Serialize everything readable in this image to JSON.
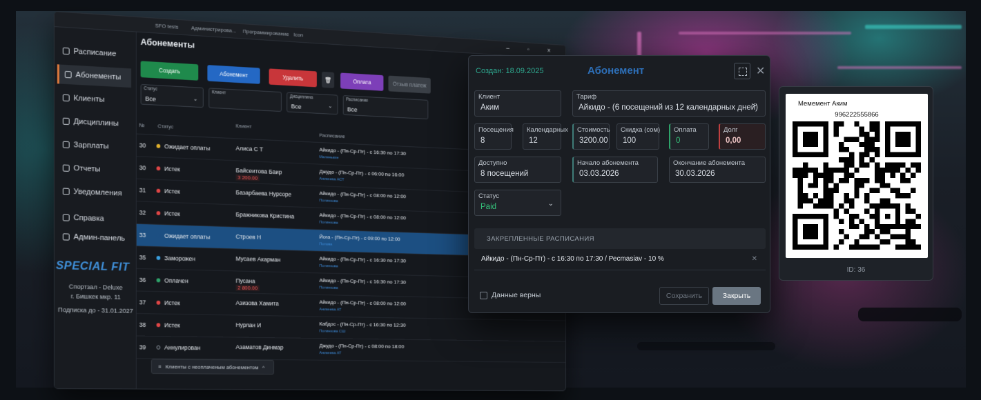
{
  "browser": {
    "bookmarks": [
      "SFO tests",
      "Администрирова...",
      "Программирование",
      "Icon"
    ],
    "window_controls": "– ▫ ×"
  },
  "sidebar": {
    "items": [
      {
        "label": "Расписание",
        "icon": "calendar-icon"
      },
      {
        "label": "Абонементы",
        "icon": "card-icon",
        "active": true
      },
      {
        "label": "Клиенты",
        "icon": "users-icon"
      },
      {
        "label": "Дисциплины",
        "icon": "layers-icon"
      },
      {
        "label": "Зарплаты",
        "icon": "wallet-icon"
      },
      {
        "label": "Отчеты",
        "icon": "report-icon"
      },
      {
        "label": "Уведомления",
        "icon": "bell-icon"
      },
      {
        "label": "Справка",
        "icon": "help-icon"
      },
      {
        "label": "Админ-панель",
        "icon": "admin-icon"
      }
    ],
    "logo": "SPECIAL FIT",
    "plan": "Спортзал - Deluxe",
    "address": "г. Бишкек мкр. 11",
    "subscription": "Подписка до - 31.01.2027"
  },
  "page": {
    "title": "Абонементы",
    "toolbar": {
      "create": "Создать",
      "subscription": "Абонемент",
      "delete": "Удалить",
      "pay": "Оплата",
      "history": "Отзыв платеж"
    },
    "filters": {
      "status_label": "Статус",
      "status_value": "Все",
      "client_label": "Клиент",
      "discipline_label": "Дисциплина",
      "discipline_value": "Все",
      "schedule_label": "Расписание",
      "schedule_value": "Все"
    },
    "columns": {
      "id": "№",
      "status": "Статус",
      "client": "Клиент",
      "schedule": "Расписание"
    },
    "rows": [
      {
        "id": "30",
        "status": "Ожидает оплаты",
        "dot": "#e0b02c",
        "client": "Алиса С Т",
        "debt": "",
        "schedule": "Айкидо - (Пн-Ср-Пт) - с 16:30 по 17:30",
        "sub": "Маленькие"
      },
      {
        "id": "30",
        "status": "Истек",
        "dot": "#e04646",
        "client": "Байсеитова Баир",
        "debt": "3 200.00",
        "schedule": "Джудо - (Пн-Ср-Пт) - с 06:00 по 16:00",
        "sub": "Аникеева АСТ"
      },
      {
        "id": "31",
        "status": "Истек",
        "dot": "#e04646",
        "client": "Базарбаева Нурсоре",
        "debt": "",
        "schedule": "Айкидо - (Пн-Ср-Пт) - с 08:00 по 12:00",
        "sub": "Полинкова"
      },
      {
        "id": "32",
        "status": "Истек",
        "dot": "#e04646",
        "client": "Бражникова Кристина",
        "debt": "",
        "schedule": "Айкидо - (Пн-Ср-Пт) - с 08:00 по 12:00",
        "sub": "Полинкова"
      },
      {
        "id": "33",
        "status": "Ожидает оплаты",
        "dot": "#1c4f82",
        "client": "Строев Н",
        "debt": "",
        "schedule": "Йога - (Пн-Ср-Пт) - с 09:00 по 12:00",
        "sub": "Попова",
        "selected": true
      },
      {
        "id": "35",
        "status": "Заморожен",
        "dot": "#3aa0e0",
        "client": "Мусаев Акарман",
        "debt": "",
        "schedule": "Айкидо - (Пн-Ср-Пт) - с 16:30 по 17:30",
        "sub": "Полинкова"
      },
      {
        "id": "36",
        "status": "Оплачен",
        "dot": "#2ea36a",
        "client": "Пусана",
        "debt": "2 800.00",
        "schedule": "Айкидо - (Пн-Ср-Пт) - с 16:30 по 17:30",
        "sub": "Полинкова"
      },
      {
        "id": "37",
        "status": "Истек",
        "dot": "#e04646",
        "client": "Азизова Хамита",
        "debt": "",
        "schedule": "Айкидо - (Пн-Ср-Пт) - с 08:00 по 12:00",
        "sub": "Аникеева АТ"
      },
      {
        "id": "38",
        "status": "Истек",
        "dot": "#e04646",
        "client": "Нурлан И",
        "debt": "",
        "schedule": "Кабдос - (Пн-Ср-Пт) - с 16:30 по 12:30",
        "sub": "Полинкова СШ"
      },
      {
        "id": "39",
        "status": "Аннулирован",
        "dot": "#1a1d22",
        "client": "Азаматов Динмар",
        "debt": "",
        "schedule": "Джудо - (Пн-Ср-Пт) - с 08:00 по 18:00",
        "sub": "Аникеева АТ"
      }
    ],
    "footer": "Клиенты с неоплаченым абонементом"
  },
  "modal": {
    "created": "Создан: 18.09.2025",
    "title": "Абонемент",
    "client_label": "Клиент",
    "client_value": "Аким",
    "tariff_label": "Тариф",
    "tariff_value": "Айкидо - (6 посещений из 12 календарных дней)",
    "visits_label": "Посещения",
    "visits_value": "8",
    "calendar_label": "Календарных",
    "calendar_value": "12",
    "cost_label": "Стоимость",
    "cost_value": "3200.00",
    "discount_label": "Скидка (сом)",
    "discount_value": "100",
    "payment_label": "Оплата",
    "payment_value": "0",
    "debt_label": "Долг",
    "debt_value": "0,00",
    "available_label": "Доступно",
    "available_value": "8 посещений",
    "start_label": "Начало абонемента",
    "start_value": "03.03.2026",
    "end_label": "Окончание абонемента",
    "end_value": "30.03.2026",
    "status_label": "Статус",
    "status_value": "Paid",
    "section": "ЗАКРЕПЛЕННЫЕ РАСПИСАНИЯ",
    "schedule_item": "Айкидо - (Пн-Ср-Пт) - с 16:30 по 17:30 / Ресmasiav - 10 %",
    "checkbox": "Данные верны",
    "save": "Сохранить",
    "close": "Закрыть"
  },
  "qr_card": {
    "name": "Мемемент Аким",
    "phone": "996222555866",
    "id": "ID: 36"
  }
}
